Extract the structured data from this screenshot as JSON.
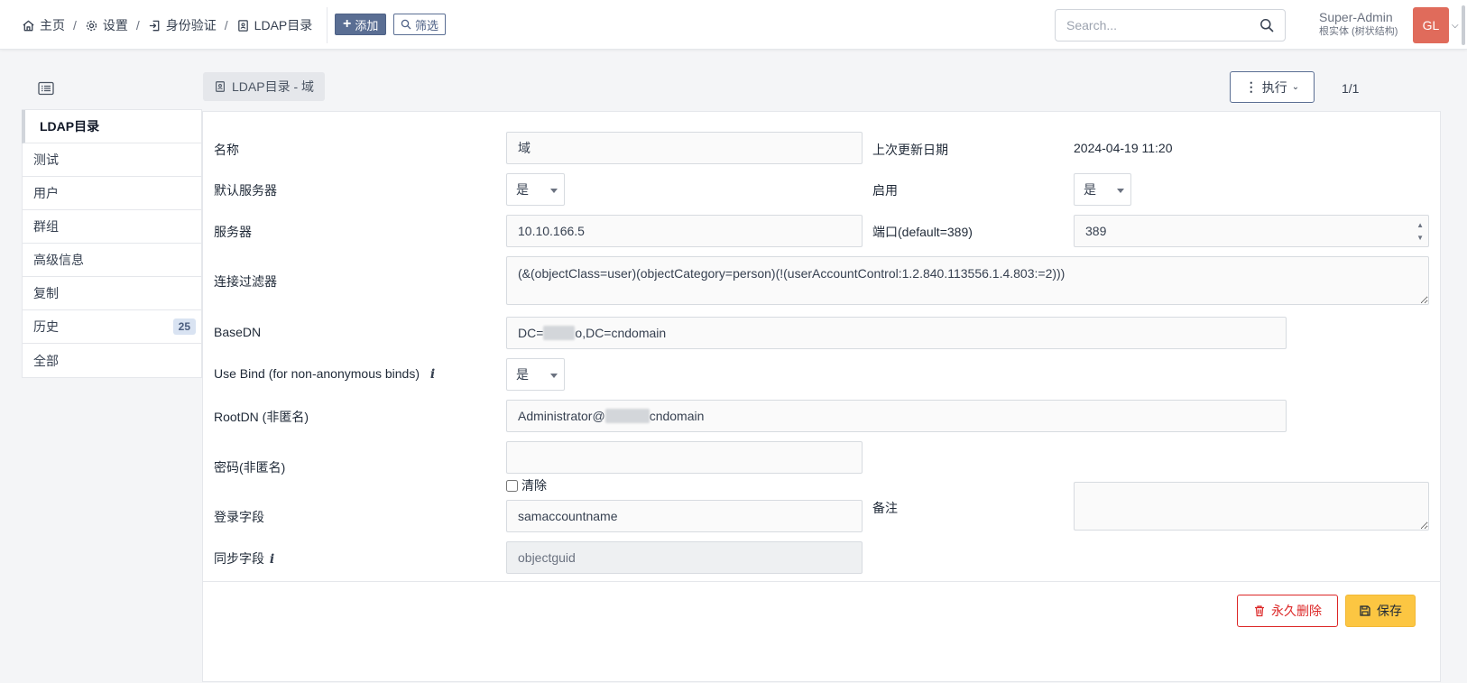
{
  "breadcrumb": {
    "home": "主页",
    "settings": "设置",
    "auth": "身份验证",
    "ldap": "LDAP目录"
  },
  "toolbar": {
    "add_label": "添加",
    "filter_label": "筛选"
  },
  "search": {
    "placeholder": "Search..."
  },
  "user": {
    "name": "Super-Admin",
    "entity": "根实体 (树状结构)",
    "initials": "GL"
  },
  "tabs": [
    {
      "label": "LDAP目录"
    },
    {
      "label": "测试"
    },
    {
      "label": "用户"
    },
    {
      "label": "群组"
    },
    {
      "label": "高级信息"
    },
    {
      "label": "复制"
    },
    {
      "label": "历史",
      "count": "25"
    },
    {
      "label": "全部"
    }
  ],
  "header": {
    "title": "LDAP目录 - 域",
    "exec_label": "执行",
    "pager": "1/1"
  },
  "form": {
    "name_label": "名称",
    "name_value": "域",
    "last_update_label": "上次更新日期",
    "last_update_value": "2024-04-19 11:20",
    "default_server_label": "默认服务器",
    "default_server_value": "是",
    "active_label": "启用",
    "active_value": "是",
    "server_label": "服务器",
    "server_value": "10.10.166.5",
    "port_label": "端口(default=389)",
    "port_value": "389",
    "filter_label": "连接过滤器",
    "filter_value": "(&(objectClass=user)(objectCategory=person)(!(userAccountControl:1.2.840.113556.1.4.803:=2)))",
    "basedn_label": "BaseDN",
    "basedn_prefix": "DC=",
    "basedn_redacted": "xxxxx",
    "basedn_suffix": "o,DC=cndomain",
    "usebind_label": "Use Bind (for non-anonymous binds)",
    "usebind_value": "是",
    "rootdn_label": "RootDN (非匿名)",
    "rootdn_prefix": "Administrator@",
    "rootdn_redacted": "xxxxxxx",
    "rootdn_suffix": "cndomain",
    "password_label": "密码(非匿名)",
    "password_value": "",
    "clear_label": "清除",
    "comment_label": "备注",
    "comment_value": "",
    "login_field_label": "登录字段",
    "login_field_value": "samaccountname",
    "sync_field_label": "同步字段",
    "sync_field_value": "objectguid"
  },
  "actions": {
    "delete_label": "永久删除",
    "save_label": "保存"
  },
  "colors": {
    "primary": "#5a6e93",
    "danger": "#dc2626",
    "save": "#fcc642",
    "avatar": "#e06b5b"
  }
}
